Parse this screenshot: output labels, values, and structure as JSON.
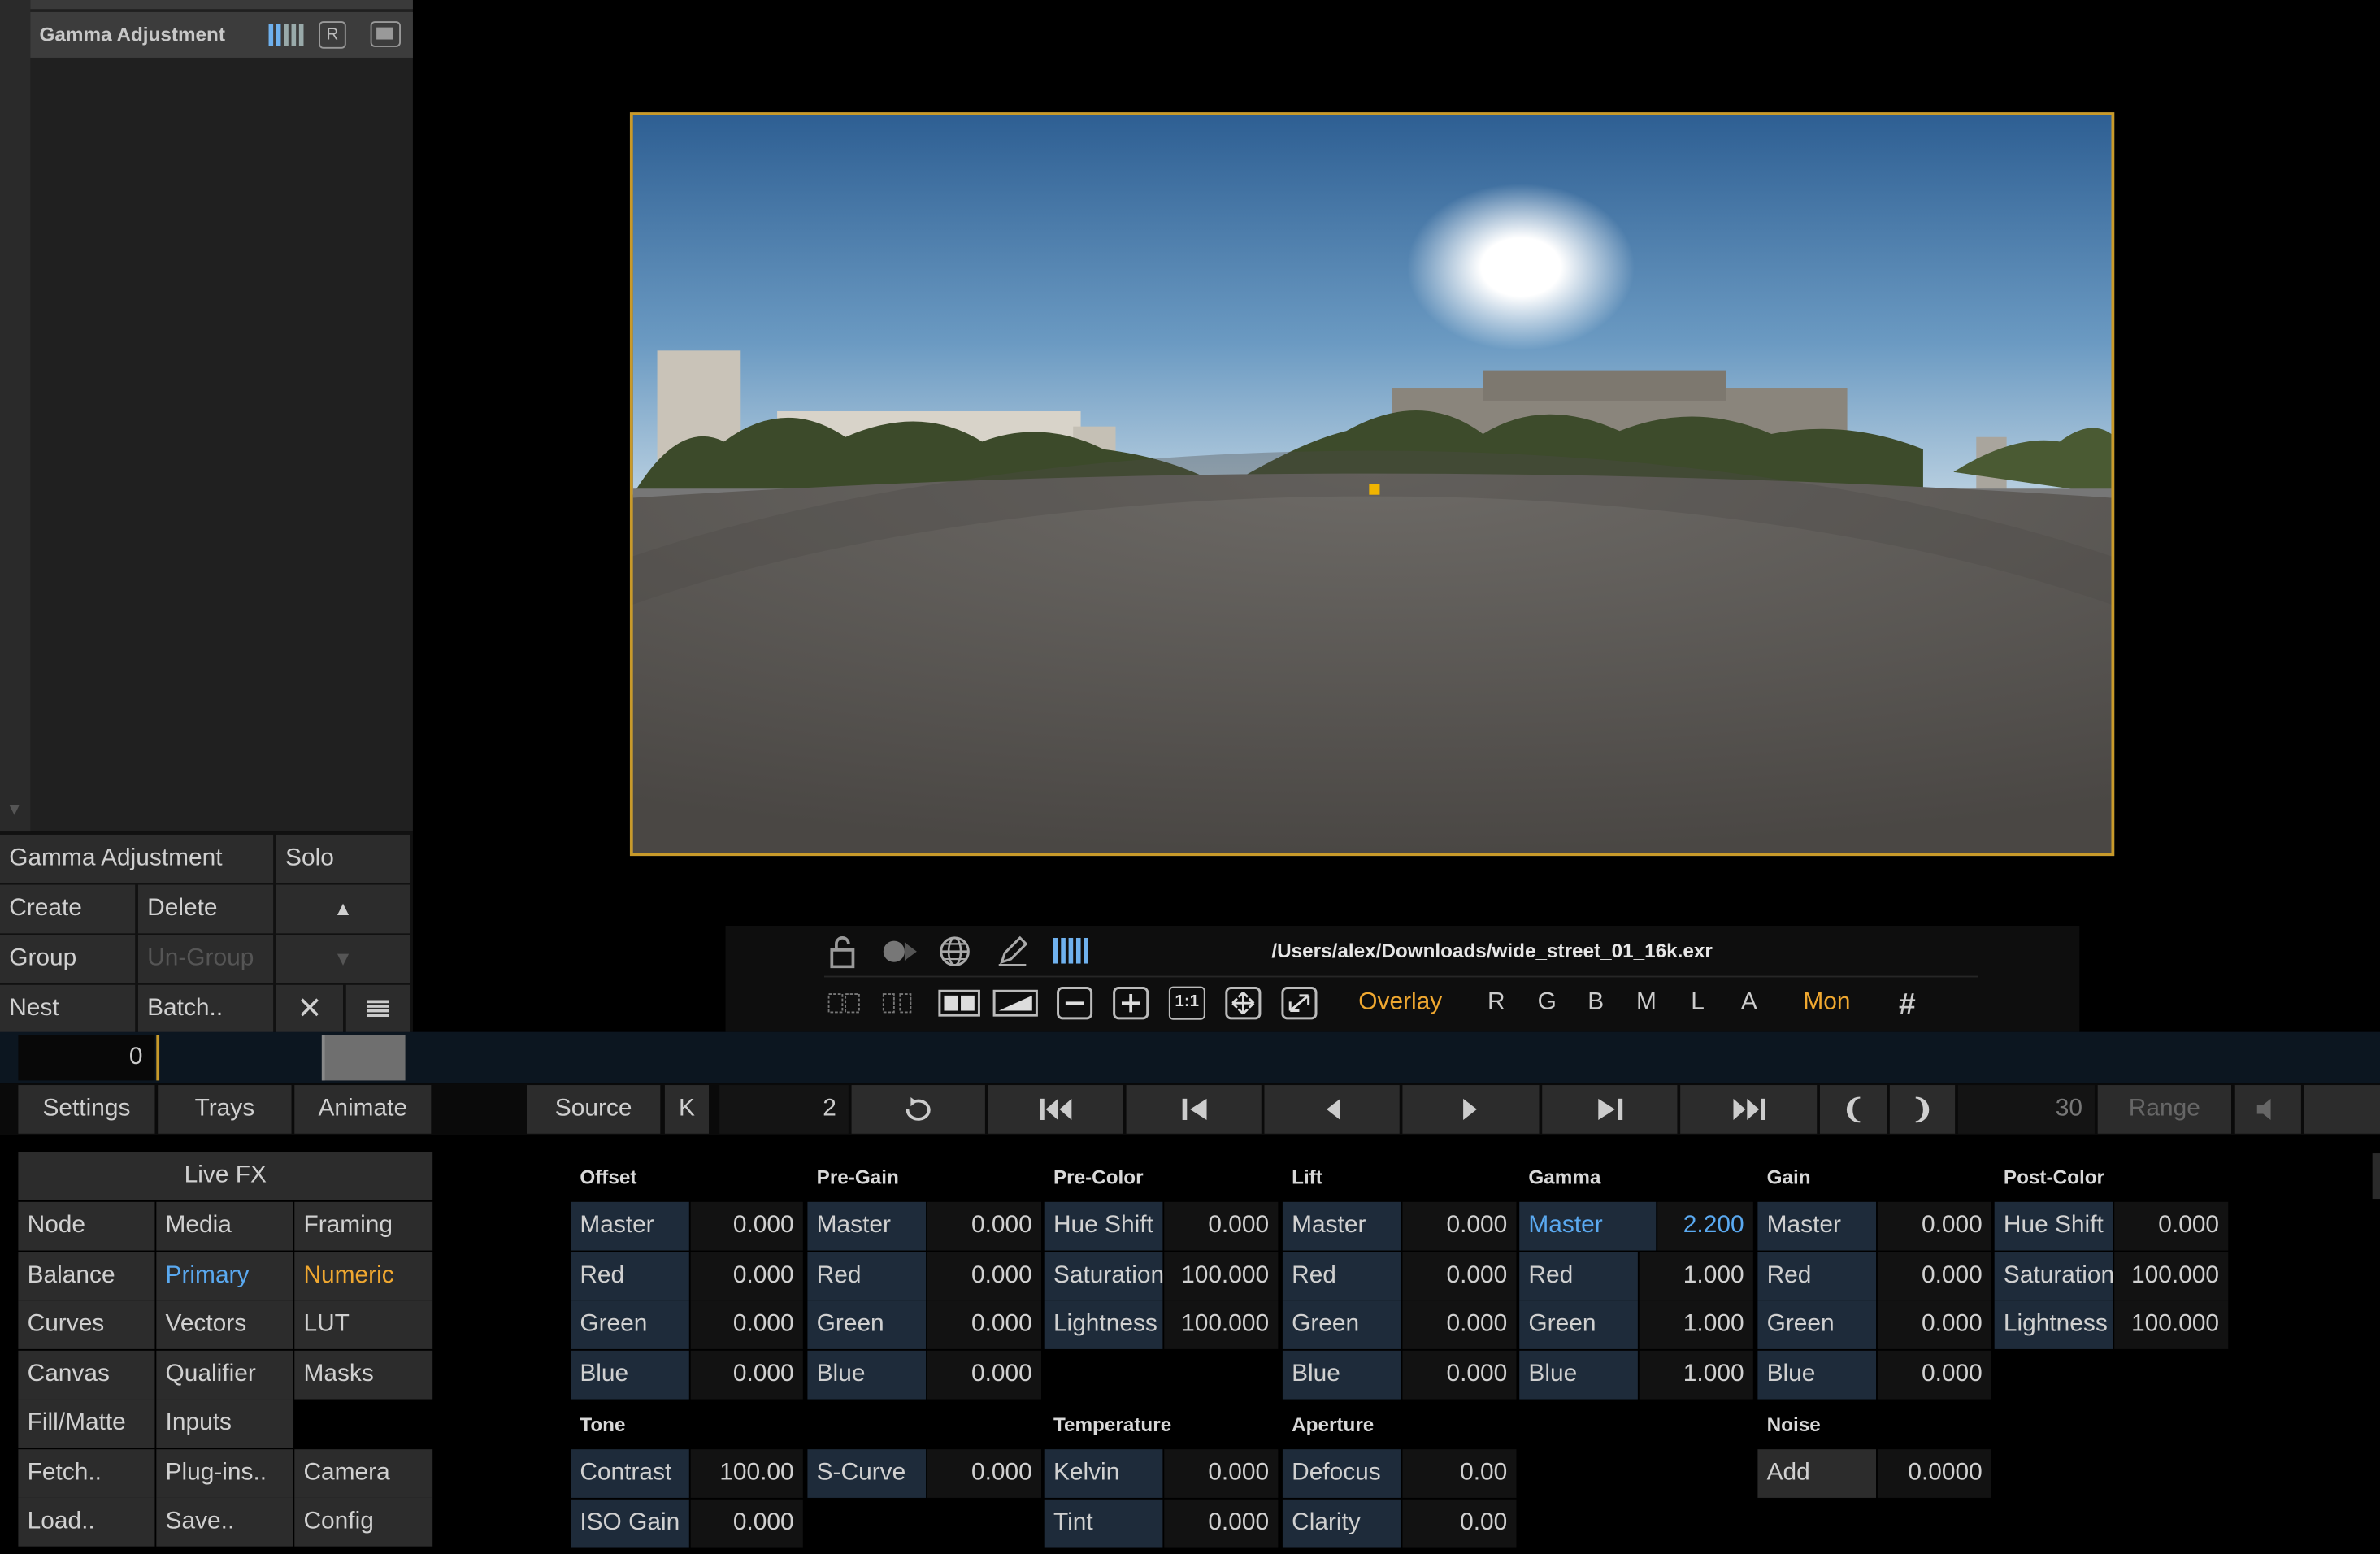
{
  "layer_list": {
    "active_layer": "Gamma Adjustment"
  },
  "node_controls": {
    "layer_name": "Gamma Adjustment",
    "solo": "Solo",
    "create": "Create",
    "delete": "Delete",
    "group": "Group",
    "ungroup": "Un-Group",
    "nest": "Nest",
    "batch": "Batch.."
  },
  "viewer": {
    "file_path": "/Users/alex/Downloads/wide_street_01_16k.exr",
    "overlay": "Overlay",
    "channels": [
      "R",
      "G",
      "B",
      "M",
      "L",
      "A"
    ],
    "mon": "Mon",
    "zoom_11": "1:1"
  },
  "timeline": {
    "current_frame": "0"
  },
  "transport": {
    "settings": "Settings",
    "trays": "Trays",
    "animate": "Animate",
    "source": "Source",
    "k": "K",
    "frame": "2",
    "end_frame": "30",
    "range": "Range"
  },
  "menu": {
    "title": "Live FX",
    "items": [
      [
        "Node",
        "Media",
        "Framing"
      ],
      [
        "Balance",
        "Primary",
        "Numeric"
      ],
      [
        "Curves",
        "Vectors",
        "LUT"
      ],
      [
        "Canvas",
        "Qualifier",
        "Masks"
      ],
      [
        "Fill/Matte",
        "Inputs",
        ""
      ],
      [
        "Fetch..",
        "Plug-ins..",
        "Camera"
      ],
      [
        "Load..",
        "Save..",
        "Config"
      ]
    ]
  },
  "grading": {
    "offset": {
      "title": "Offset",
      "rows": [
        [
          "Master",
          "0.000"
        ],
        [
          "Red",
          "0.000"
        ],
        [
          "Green",
          "0.000"
        ],
        [
          "Blue",
          "0.000"
        ]
      ]
    },
    "pregain": {
      "title": "Pre-Gain",
      "rows": [
        [
          "Master",
          "0.000"
        ],
        [
          "Red",
          "0.000"
        ],
        [
          "Green",
          "0.000"
        ],
        [
          "Blue",
          "0.000"
        ]
      ]
    },
    "precolor": {
      "title": "Pre-Color",
      "rows": [
        [
          "Hue Shift",
          "0.000"
        ],
        [
          "Saturation",
          "100.000"
        ],
        [
          "Lightness",
          "100.000"
        ]
      ]
    },
    "lift": {
      "title": "Lift",
      "rows": [
        [
          "Master",
          "0.000"
        ],
        [
          "Red",
          "0.000"
        ],
        [
          "Green",
          "0.000"
        ],
        [
          "Blue",
          "0.000"
        ]
      ]
    },
    "gamma": {
      "title": "Gamma",
      "rows": [
        [
          "Master",
          "2.200"
        ],
        [
          "Red",
          "1.000"
        ],
        [
          "Green",
          "1.000"
        ],
        [
          "Blue",
          "1.000"
        ]
      ]
    },
    "gain": {
      "title": "Gain",
      "rows": [
        [
          "Master",
          "0.000"
        ],
        [
          "Red",
          "0.000"
        ],
        [
          "Green",
          "0.000"
        ],
        [
          "Blue",
          "0.000"
        ]
      ]
    },
    "postcolor": {
      "title": "Post-Color",
      "rows": [
        [
          "Hue Shift",
          "0.000"
        ],
        [
          "Saturation",
          "100.000"
        ],
        [
          "Lightness",
          "100.000"
        ]
      ]
    },
    "tone": {
      "title": "Tone",
      "contrast": [
        "Contrast",
        "100.00"
      ],
      "scurve": [
        "S-Curve",
        "0.000"
      ],
      "iso": [
        "ISO Gain",
        "0.000"
      ]
    },
    "temperature": {
      "title": "Temperature",
      "kelvin": [
        "Kelvin",
        "0.000"
      ],
      "tint": [
        "Tint",
        "0.000"
      ]
    },
    "aperture": {
      "title": "Aperture",
      "defocus": [
        "Defocus",
        "0.00"
      ],
      "clarity": [
        "Clarity",
        "0.00"
      ]
    },
    "noise": {
      "title": "Noise",
      "add": [
        "Add",
        "0.0000"
      ]
    }
  },
  "colors": {
    "accent_blue": "#5aa9f0",
    "accent_orange": "#f0a830",
    "frame_border": "#c89a2a"
  }
}
